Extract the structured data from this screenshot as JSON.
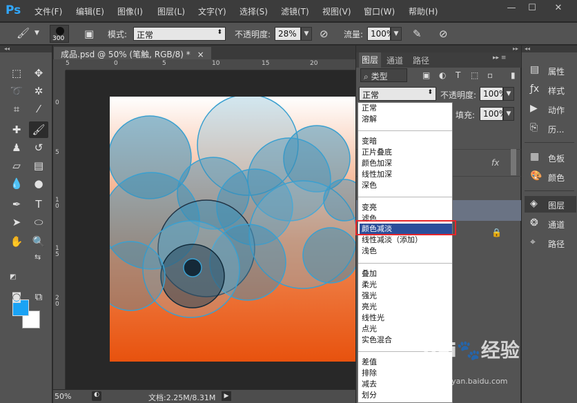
{
  "app": {
    "logo": "Ps",
    "menus": [
      "文件(F)",
      "编辑(E)",
      "图像(I)",
      "图层(L)",
      "文字(Y)",
      "选择(S)",
      "滤镜(T)",
      "视图(V)",
      "窗口(W)",
      "帮助(H)"
    ],
    "window_buttons": [
      "—",
      "☐",
      "✕"
    ]
  },
  "options_bar": {
    "brush_size": "300",
    "mode_label": "模式:",
    "mode_value": "正常",
    "opacity_label": "不透明度:",
    "opacity_value": "28%",
    "flow_label": "流量:",
    "flow_value": "100%"
  },
  "document": {
    "tab_title": "成品.psd @ 50% (笔触, RGB/8) *",
    "tab_close": "×",
    "ruler_h": [
      "5",
      "0",
      "5",
      "10",
      "15",
      "20"
    ],
    "ruler_v": [
      "0",
      "5",
      "1\n0",
      "1\n5",
      "2\n0"
    ],
    "zoom": "50%",
    "doc_info": "文档:2.25M/8.31M",
    "colors": {
      "gradient_top": "#ffffff",
      "gradient_bottom": "#e8520e",
      "circle_fill": "#3a8fb8"
    }
  },
  "layers_panel": {
    "tabs": [
      "图层",
      "通道",
      "路径"
    ],
    "filter_label": "类型",
    "blend_value": "正常",
    "opacity_label": "不透明度:",
    "opacity_value": "100%",
    "fill_label": "填充:",
    "fill_value": "100%",
    "fx_label": "fx"
  },
  "blend_dropdown": {
    "groups": [
      [
        "正常",
        "溶解"
      ],
      [
        "变暗",
        "正片叠底",
        "颜色加深",
        "线性加深",
        "深色"
      ],
      [
        "变亮",
        "滤色",
        "颜色减淡",
        "线性减淡（添加）",
        "浅色"
      ],
      [
        "叠加",
        "柔光",
        "强光",
        "亮光",
        "线性光",
        "点光",
        "实色混合"
      ],
      [
        "差值",
        "排除",
        "减去",
        "划分"
      ]
    ],
    "selected": "颜色减淡",
    "selected_color": "#2c4e9a",
    "highlight_box_color": "#e8262a"
  },
  "dock": {
    "items": [
      {
        "icon": "properties-icon",
        "label": "属性"
      },
      {
        "icon": "styles-icon",
        "label": "样式"
      },
      {
        "icon": "actions-icon",
        "label": "动作"
      },
      {
        "icon": "history-icon",
        "label": "历..."
      },
      {
        "icon": "swatches-icon",
        "label": "色板"
      },
      {
        "icon": "color-icon",
        "label": "颜色"
      },
      {
        "icon": "layers-icon",
        "label": "图层"
      },
      {
        "icon": "channels-icon",
        "label": "通道"
      },
      {
        "icon": "paths-icon",
        "label": "路径"
      }
    ]
  },
  "watermark": {
    "text": "Bai",
    "text2": "经验",
    "sub": "jingyan.baidu.com"
  }
}
